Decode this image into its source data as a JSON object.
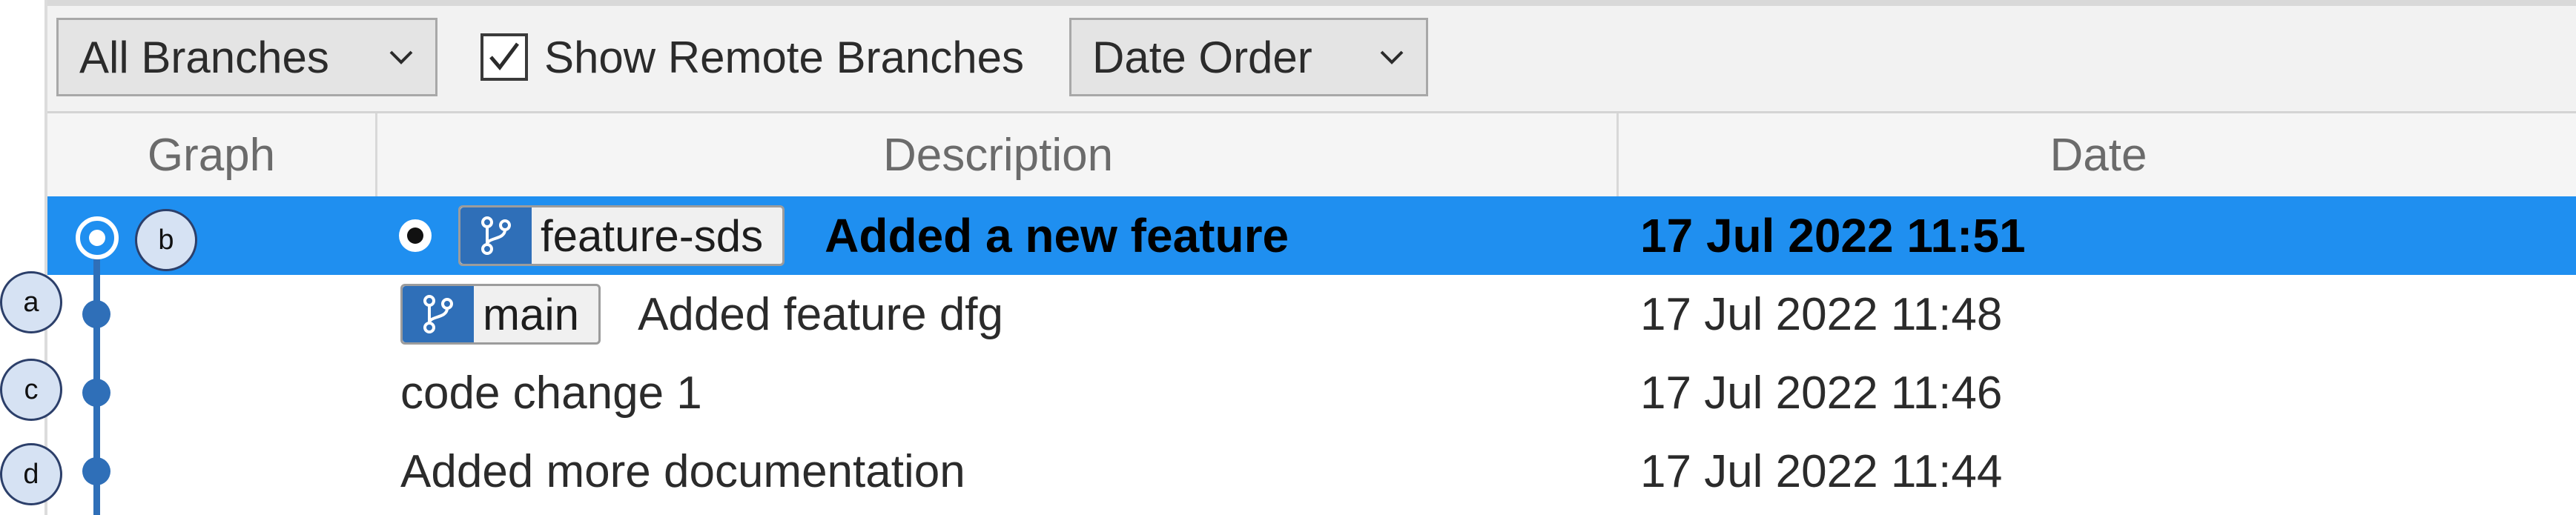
{
  "toolbar": {
    "branches_dropdown": "All Branches",
    "show_remote_label": "Show Remote Branches",
    "show_remote_checked": true,
    "order_dropdown": "Date Order"
  },
  "columns": {
    "graph": "Graph",
    "description": "Description",
    "date": "Date"
  },
  "commits": [
    {
      "branch": "feature-sds",
      "message": "Added a new feature",
      "date": "17 Jul 2022 11:51",
      "selected": true,
      "is_head": true
    },
    {
      "branch": "main",
      "message": "Added feature dfg",
      "date": "17 Jul 2022 11:48",
      "selected": false
    },
    {
      "branch": "",
      "message": "code change 1",
      "date": "17 Jul 2022 11:46",
      "selected": false
    },
    {
      "branch": "",
      "message": "Added more documentation",
      "date": "17 Jul 2022 11:44",
      "selected": false
    }
  ],
  "callouts": [
    "a",
    "b",
    "c",
    "d"
  ],
  "colors": {
    "selection": "#1f8ff0",
    "graph_line": "#2f6fb8",
    "tag_icon": "#2f6fb8"
  }
}
